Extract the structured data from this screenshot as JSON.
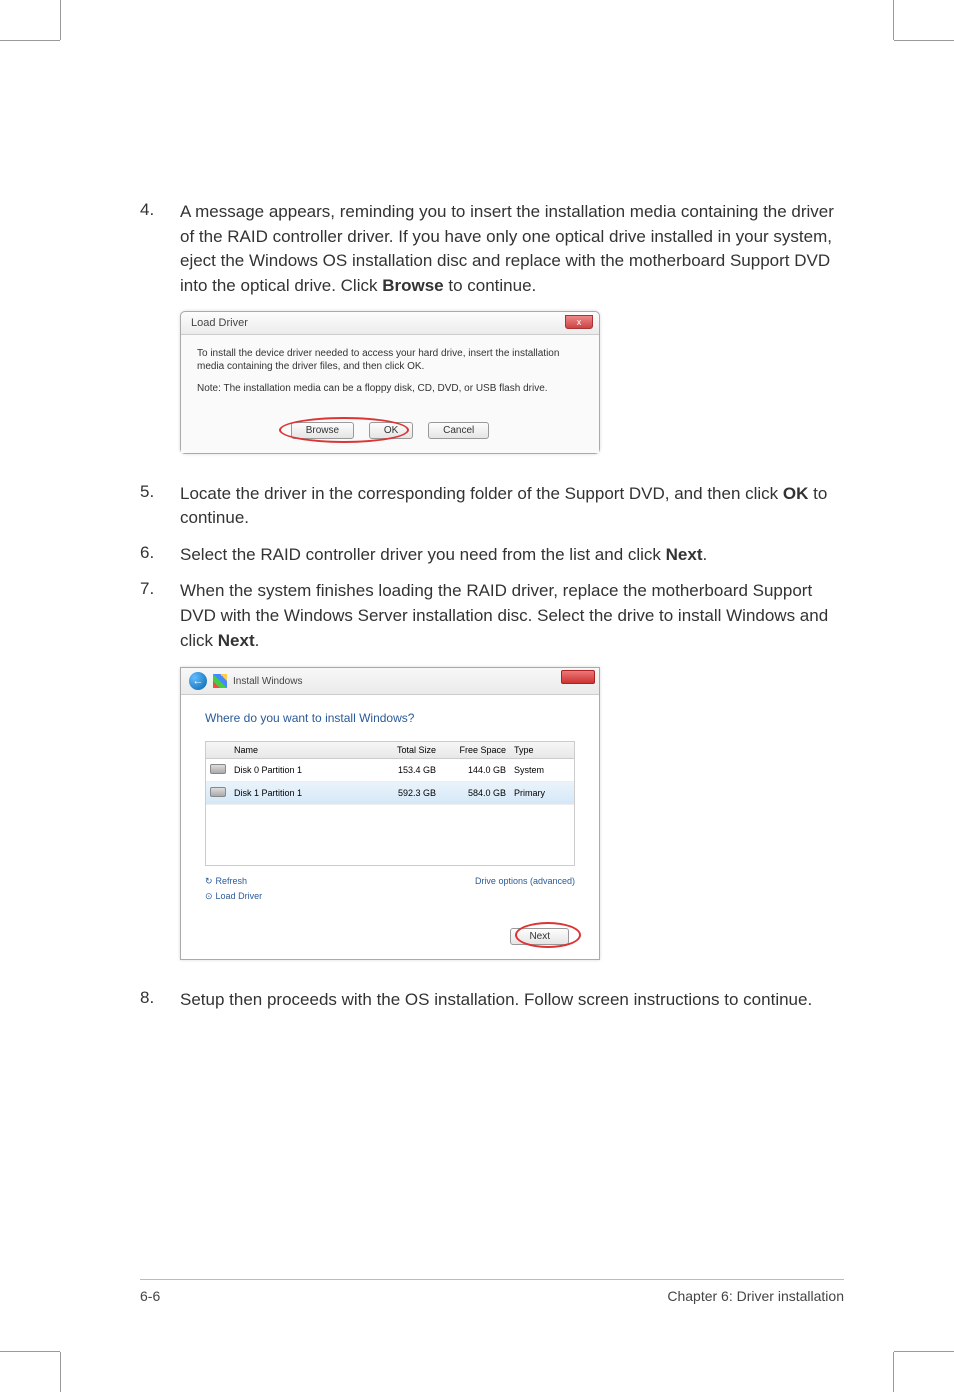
{
  "steps": {
    "s4": {
      "num": "4.",
      "text_a": "A message appears, reminding you to insert the installation media containing the driver of the RAID controller driver. If you have only one optical drive installed in your system, eject the Windows OS installation disc and replace with the motherboard Support DVD into the optical drive. Click ",
      "bold1": "Browse",
      "text_b": " to continue."
    },
    "s5": {
      "num": "5.",
      "text_a": "Locate the driver in the corresponding folder of the Support DVD, and then click ",
      "bold1": "OK",
      "text_b": " to continue."
    },
    "s6": {
      "num": "6.",
      "text_a": "Select the RAID controller driver you need from the list and click ",
      "bold1": "Next",
      "text_b": "."
    },
    "s7": {
      "num": "7.",
      "text_a": "When the system finishes loading the RAID driver, replace the motherboard Support DVD with the Windows Server installation disc. Select the drive to install Windows and click ",
      "bold1": "Next",
      "text_b": "."
    },
    "s8": {
      "num": "8.",
      "text_a": "Setup then proceeds with the OS installation. Follow screen instructions to continue."
    }
  },
  "dialog1": {
    "title": "Load Driver",
    "close": "x",
    "text1": "To install the device driver needed to access your hard drive, insert the installation media containing the driver files, and then click OK.",
    "text2": "Note: The installation media can be a floppy disk, CD, DVD, or USB flash drive.",
    "browse": "Browse",
    "ok": "OK",
    "cancel": "Cancel"
  },
  "dialog2": {
    "title": "Install Windows",
    "heading": "Where do you want to install Windows?",
    "cols": {
      "name": "Name",
      "size": "Total Size",
      "free": "Free Space",
      "type": "Type"
    },
    "rows": [
      {
        "name": "Disk 0 Partition 1",
        "size": "153.4 GB",
        "free": "144.0 GB",
        "type": "System"
      },
      {
        "name": "Disk 1 Partition 1",
        "size": "592.3 GB",
        "free": "584.0 GB",
        "type": "Primary"
      }
    ],
    "refresh": "Refresh",
    "load_driver": "Load Driver",
    "drive_options": "Drive options (advanced)",
    "next": "Next"
  },
  "footer": {
    "page": "6-6",
    "chapter": "Chapter 6: Driver installation"
  }
}
